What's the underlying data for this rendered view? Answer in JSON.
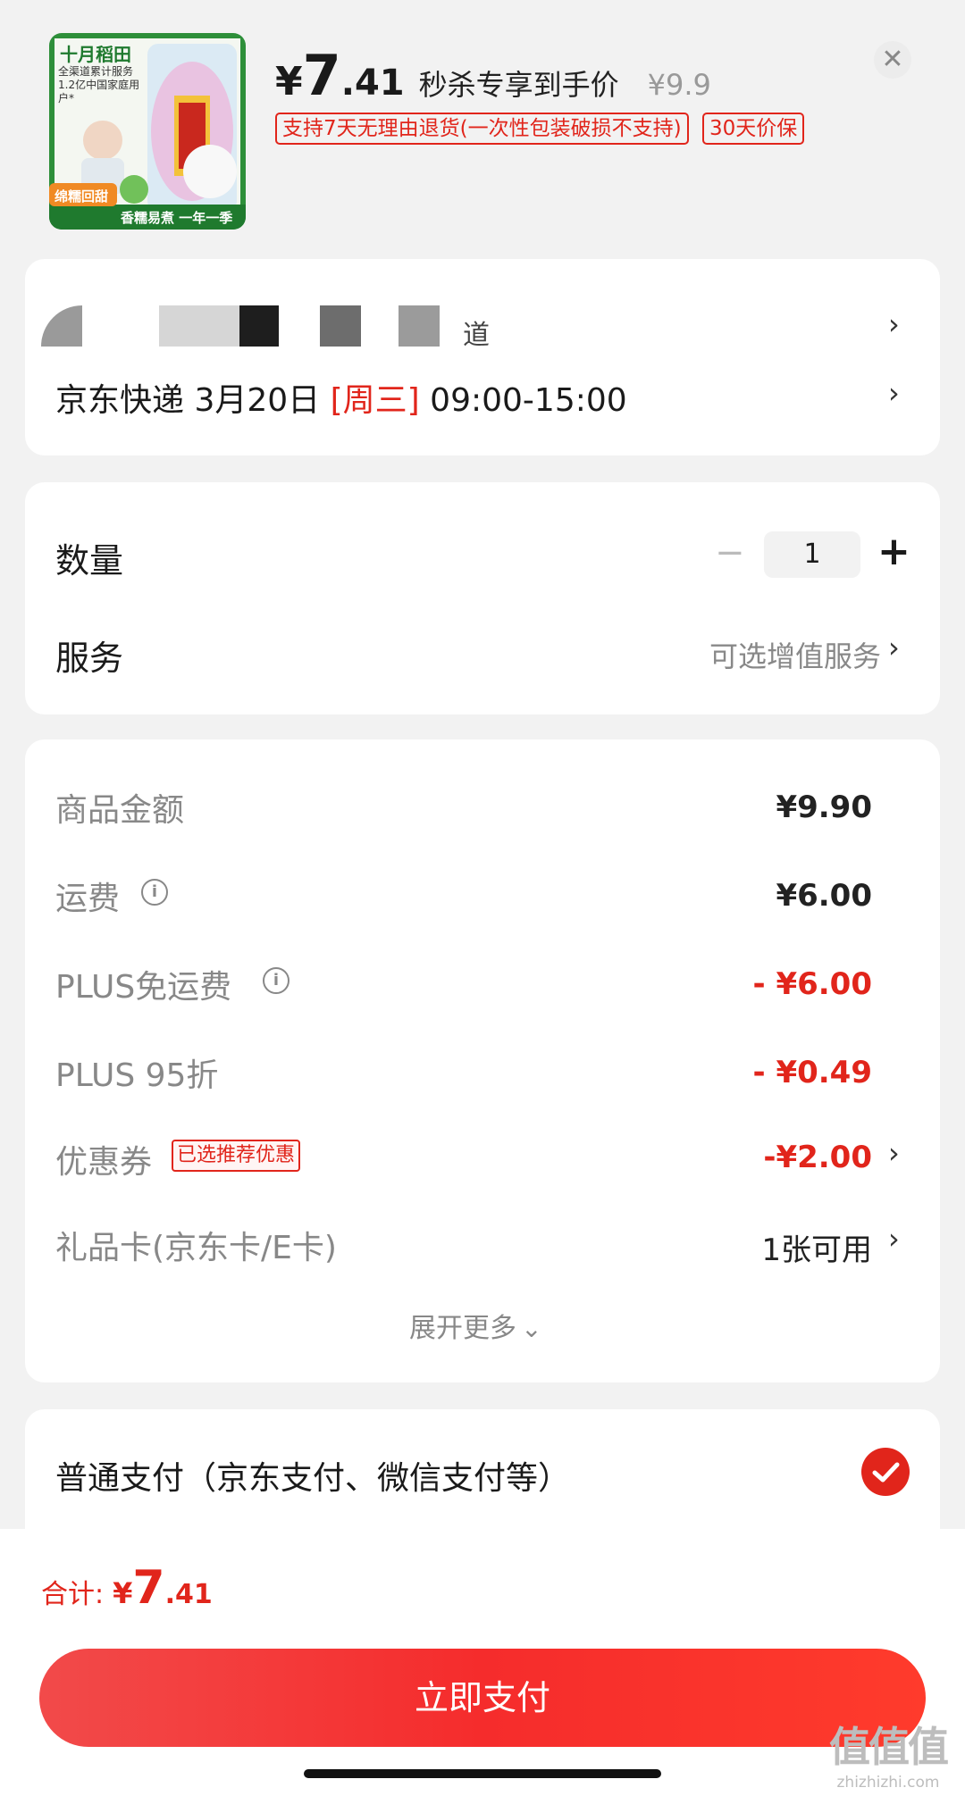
{
  "header": {
    "product_thumb_icon": "rice-bag-product-image",
    "product_thumb_brand": "十月稻田",
    "product_thumb_lines": [
      "全渠道累计服务",
      "1.2亿中国家庭用户*"
    ],
    "product_thumb_badge": "绵糯回甜",
    "product_thumb_footer": "香糯易煮 一年一季",
    "price_symbol": "¥",
    "price_int": "7",
    "price_dec": ".41",
    "price_label": "秒杀专享到手价",
    "original_price": "¥9.9",
    "tags": [
      "支持7天无理由退货(一次性包装破损不支持)",
      "30天价保"
    ],
    "close_icon": "close-icon"
  },
  "delivery": {
    "address_tail": "道",
    "shipping": "京东快递 3月20日",
    "weekday": "[周三]",
    "time": "09:00-15:00"
  },
  "quantity": {
    "label": "数量",
    "value": "1",
    "minus": "−",
    "plus": "+"
  },
  "service": {
    "label": "服务",
    "value": "可选增值服务"
  },
  "costs": {
    "items_label": "商品金额",
    "items_value": "¥9.90",
    "shipping_label": "运费",
    "shipping_value": "¥6.00",
    "plus_ship_label": "PLUS免运费",
    "plus_ship_value": "- ¥6.00",
    "plus_disc_label": "PLUS 95折",
    "plus_disc_value": "- ¥0.49",
    "coupon_label": "优惠券",
    "coupon_tag": "已选推荐优惠",
    "coupon_value": "-¥2.00",
    "giftcard_label": "礼品卡(京东卡/E卡)",
    "giftcard_value": "1张可用",
    "expand_label": "展开更多"
  },
  "payment": {
    "method": "普通支付（京东支付、微信支付等）"
  },
  "footer": {
    "total_label": "合计:",
    "total_symbol": "¥",
    "total_int": "7",
    "total_dec": ".41",
    "pay_button": "立即支付",
    "watermark": "值值值",
    "watermark_url": "zhizhizhi.com"
  },
  "colors": {
    "accent": "#e1251b",
    "background": "#f2f2f2"
  }
}
